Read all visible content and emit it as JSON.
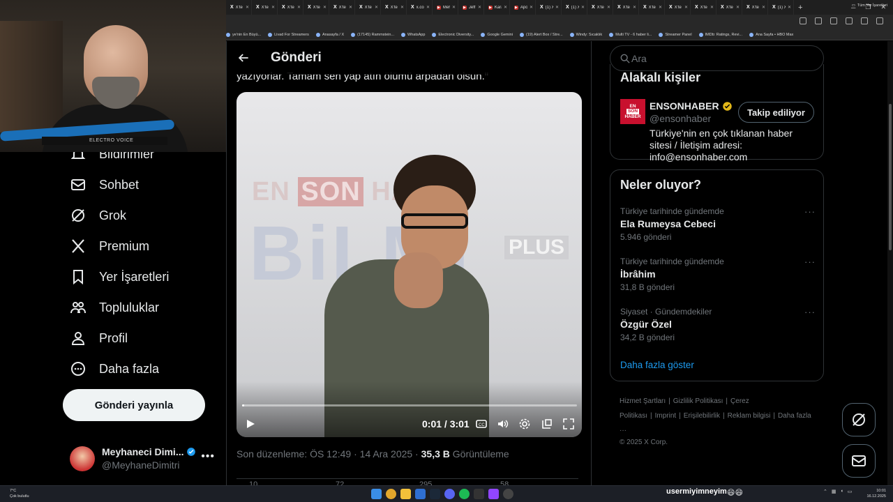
{
  "browser": {
    "tabs": [
      "X'te",
      "X'te",
      "X'te",
      "X'te",
      "X'te",
      "X'te",
      "X'te",
      "x.co",
      "Meh",
      "Jeff",
      "Kara",
      "Apo",
      "(1) X",
      "(1) X",
      "X'te",
      "X'te",
      "X'te",
      "X'te",
      "X'te",
      "X'te",
      "X'te",
      "(1) X"
    ],
    "bookmarks": [
      "ye'nin En Büyü...",
      "Livad For Streamers",
      "Anasayfa / X",
      "(17145) Rammstein...",
      "WhatsApp",
      "Electronic Diversity...",
      "Google Gemini",
      "(19) Alert Box / Stre...",
      "Windy: Sıcaklık",
      "Multi TV - 6 haber li...",
      "Streamer Panel",
      "IMDb: Ratings, Revi...",
      "Ana Sayfa • HBO Max"
    ],
    "bookmarks_right": "Tüm Yer İşaretleri"
  },
  "webcam": {
    "mic_label": "ELECTRO VOICE"
  },
  "nav": {
    "partial_item": "Bildirimler",
    "items": [
      "Sohbet",
      "Grok",
      "Premium",
      "Yer İşaretleri",
      "Topluluklar",
      "Profil",
      "Daha fazla"
    ],
    "post_button": "Gönderi yayınla",
    "profile_name": "Meyhaneci Dimi...",
    "profile_handle": "@MeyhaneDimitri"
  },
  "post": {
    "header_title": "Gönderi",
    "quote_text": "yazıyorlar. Tamam sen yap atın ölümü arpadan olsun.\"",
    "video": {
      "brand_text_1": "EN",
      "brand_text_2": "SON",
      "brand_text_3": "HA",
      "brand_big": "BiLMi",
      "brand_plus": "PLUS",
      "time": "0:01 / 3:01",
      "progress": 0.006
    },
    "meta_prefix": "Son düzenleme: ÖS 12:49 · 14 Ara 2025 ·",
    "views_value": "35,3 B",
    "views_label": "Görüntüleme",
    "action_counts": [
      "10",
      "72",
      "295",
      "58"
    ]
  },
  "search": {
    "placeholder": "Ara"
  },
  "related": {
    "title": "Alakalı kişiler",
    "name": "ENSONHABER",
    "handle": "@ensonhaber",
    "follow_label": "Takip ediliyor",
    "bio": "Türkiye'nin en çok tıklanan haber sitesi / İletişim adresi: info@ensonhaber.com",
    "logo_lines": [
      "EN",
      "SON",
      "HABER"
    ]
  },
  "trends": {
    "title": "Neler oluyor?",
    "items": [
      {
        "context": "Türkiye tarihinde gündemde",
        "topic": "Ela Rumeysa Cebeci",
        "count": "5.946 gönderi"
      },
      {
        "context": "Türkiye tarihinde gündemde",
        "topic": "İbrâhim",
        "count": "31,8 B gönderi"
      },
      {
        "context": "Siyaset · Gündemdekiler",
        "topic": "Özgür Özel",
        "count": "34,2 B gönderi"
      }
    ],
    "show_more": "Daha fazla göster"
  },
  "footer": {
    "links": [
      "Hizmet Şartları",
      "|",
      "Gizlilik Politikası",
      "|",
      "Çerez Politikası",
      "|",
      "Imprint",
      "|",
      "Erişilebilirlik",
      "|",
      "Reklam bilgisi",
      "|",
      "Daha fazla ···"
    ],
    "copyright": "© 2025 X Corp."
  },
  "taskbar": {
    "weather_temp": "7°C",
    "weather_desc": "Çok bulutlu",
    "overlay_text": "usermiyimneyim",
    "emoji": "😄😄",
    "time": "10:01",
    "date": "16.12.2025"
  },
  "colors": {
    "accent": "#1d9bf0",
    "background": "#000000",
    "verified": "#1d9bf0",
    "gold_badge": "#e2b719"
  }
}
